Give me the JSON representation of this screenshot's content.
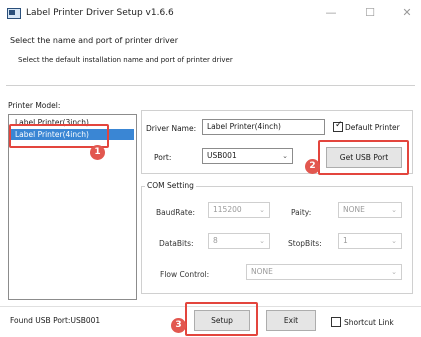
{
  "window": {
    "title": "Label Printer Driver Setup v1.6.6",
    "minimize_glyph": "—",
    "maximize_glyph": "☐",
    "close_glyph": "✕"
  },
  "header": {
    "line1": "Select the name and port of printer driver",
    "line2": "Select the default installation name and port of printer driver"
  },
  "printer_model": {
    "label": "Printer Model:",
    "items": [
      "Label Printer(3inch)",
      "Label Printer(4inch)"
    ],
    "selected_index": 1
  },
  "driver": {
    "name_label": "Driver Name:",
    "name_value": "Label Printer(4inch)",
    "default_printer_label": "Default Printer",
    "default_printer_checked": true,
    "port_label": "Port:",
    "port_value": "USB001",
    "get_usb_port_label": "Get USB Port"
  },
  "com": {
    "group_label": "COM Setting",
    "baudrate_label": "BaudRate:",
    "baudrate_value": "115200",
    "parity_label": "Paity:",
    "parity_value": "NONE",
    "databits_label": "DataBits:",
    "databits_value": "8",
    "stopbits_label": "StopBits:",
    "stopbits_value": "1",
    "flow_label": "Flow Control:",
    "flow_value": "NONE"
  },
  "footer": {
    "status": "Found USB Port:USB001",
    "setup_label": "Setup",
    "exit_label": "Exit",
    "shortcut_label": "Shortcut Link",
    "shortcut_checked": false
  },
  "annotations": {
    "badge1": "1",
    "badge2": "2",
    "badge3": "3",
    "color": "#e3453d"
  },
  "icons": {
    "check": "✓",
    "dropdown": "⌄"
  }
}
